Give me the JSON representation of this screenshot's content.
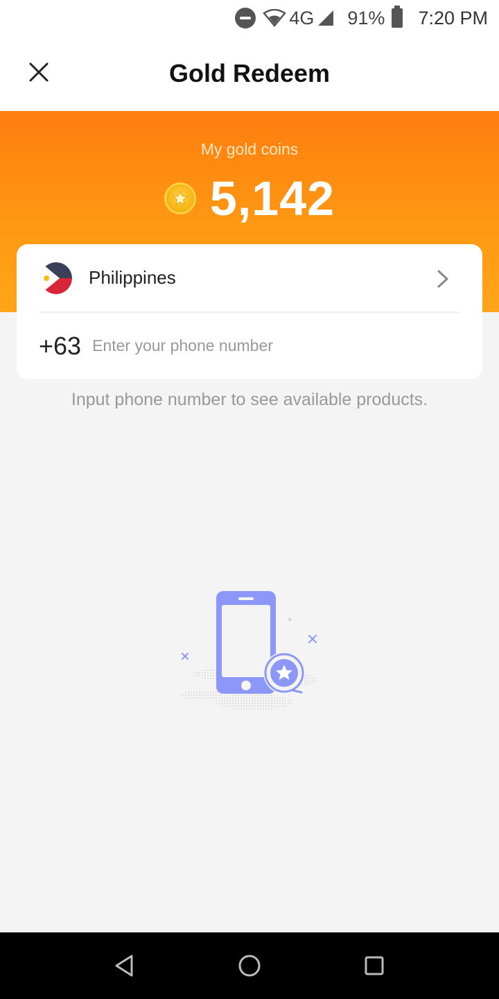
{
  "status_bar": {
    "network": "4G",
    "battery": "91%",
    "time": "7:20 PM"
  },
  "header": {
    "title": "Gold Redeem"
  },
  "balance": {
    "label": "My gold coins",
    "amount": "5,142"
  },
  "country_selector": {
    "country": "Philippines"
  },
  "phone": {
    "code": "+63",
    "placeholder": "Enter your phone number",
    "value": ""
  },
  "hint": "Input phone number to see available products.",
  "colors": {
    "banner_top": "#ff7d10",
    "banner_bottom": "#ffa51a",
    "illustration": "#8c97f7"
  },
  "icons": {
    "close": "close-icon",
    "chevron": "chevron-right-icon",
    "coin": "gold-coin-icon",
    "flag": "philippines-flag-icon"
  }
}
